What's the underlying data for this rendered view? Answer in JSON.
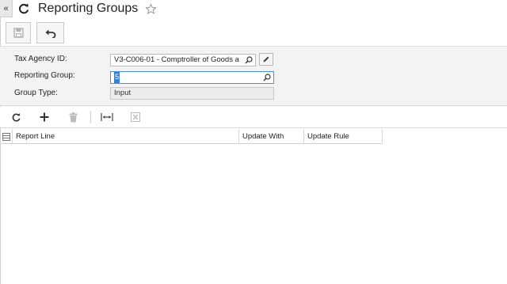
{
  "header": {
    "collapse_glyph": "«",
    "title": "Reporting Groups"
  },
  "form": {
    "tax_agency_label": "Tax Agency ID:",
    "tax_agency_value": "V3-C006-01 - Comptroller of Goods a",
    "reporting_group_label": "Reporting Group:",
    "reporting_group_value": "5",
    "group_type_label": "Group Type:",
    "group_type_value": "Input"
  },
  "grid": {
    "columns": [
      "Report Line",
      "Update With",
      "Update Rule"
    ]
  },
  "colors": {
    "accent": "#4a90d9",
    "form_background": "#f3f3f3",
    "disabled_icon": "#bdbdbd"
  }
}
